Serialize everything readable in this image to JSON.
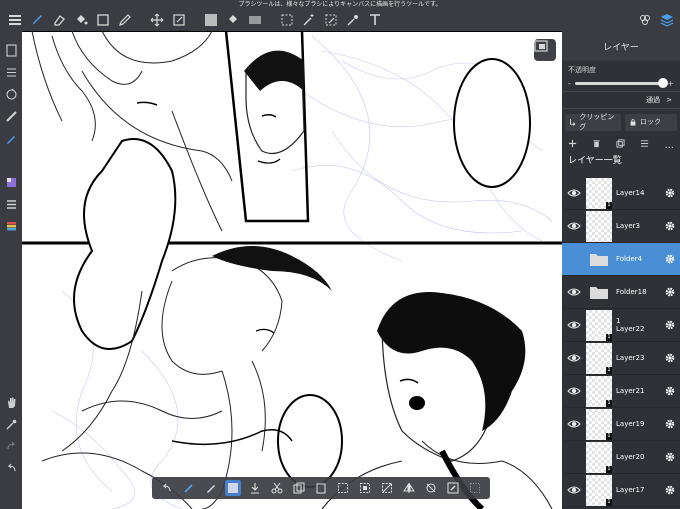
{
  "hint_text": "ブラシツールは、様々なブラシによりキャンバスに描画を行うツールです。",
  "panel": {
    "title": "レイヤー",
    "opacity_label": "不透明度",
    "opacity_minus": "-",
    "opacity_plus": "+",
    "opacity_value": 1.0,
    "blend_mode": "通過",
    "blend_chevron": ">",
    "clipping_label": "クリッピング",
    "lock_label": "ロック",
    "list_title": "レイヤー一覧",
    "actions_more": "..."
  },
  "layers": [
    {
      "name": "Layer14",
      "visible": true,
      "type": "layer",
      "badge": "1",
      "selected": false
    },
    {
      "name": "Layer3",
      "visible": true,
      "type": "layer",
      "badge": "",
      "selected": false
    },
    {
      "name": "Folder4",
      "visible": false,
      "type": "folder",
      "badge": "",
      "selected": true
    },
    {
      "name": "Folder18",
      "visible": true,
      "type": "folder",
      "badge": "",
      "selected": false
    },
    {
      "name": "1\nLayer22",
      "visible": true,
      "type": "layer",
      "badge": "1",
      "selected": false
    },
    {
      "name": "Layer23",
      "visible": true,
      "type": "layer",
      "badge": "1",
      "selected": false
    },
    {
      "name": "Layer21",
      "visible": true,
      "type": "layer",
      "badge": "1",
      "selected": false
    },
    {
      "name": "Layer19",
      "visible": true,
      "type": "layer",
      "badge": "1",
      "selected": false
    },
    {
      "name": "Layer20",
      "visible": false,
      "type": "layer",
      "badge": "1",
      "selected": false
    },
    {
      "name": "Layer17",
      "visible": true,
      "type": "layer",
      "badge": "1",
      "selected": false
    }
  ],
  "colors": {
    "accent": "#4a8fd6",
    "toolbar_bg": "#3a3c41",
    "panel_bg": "#2f3136"
  }
}
